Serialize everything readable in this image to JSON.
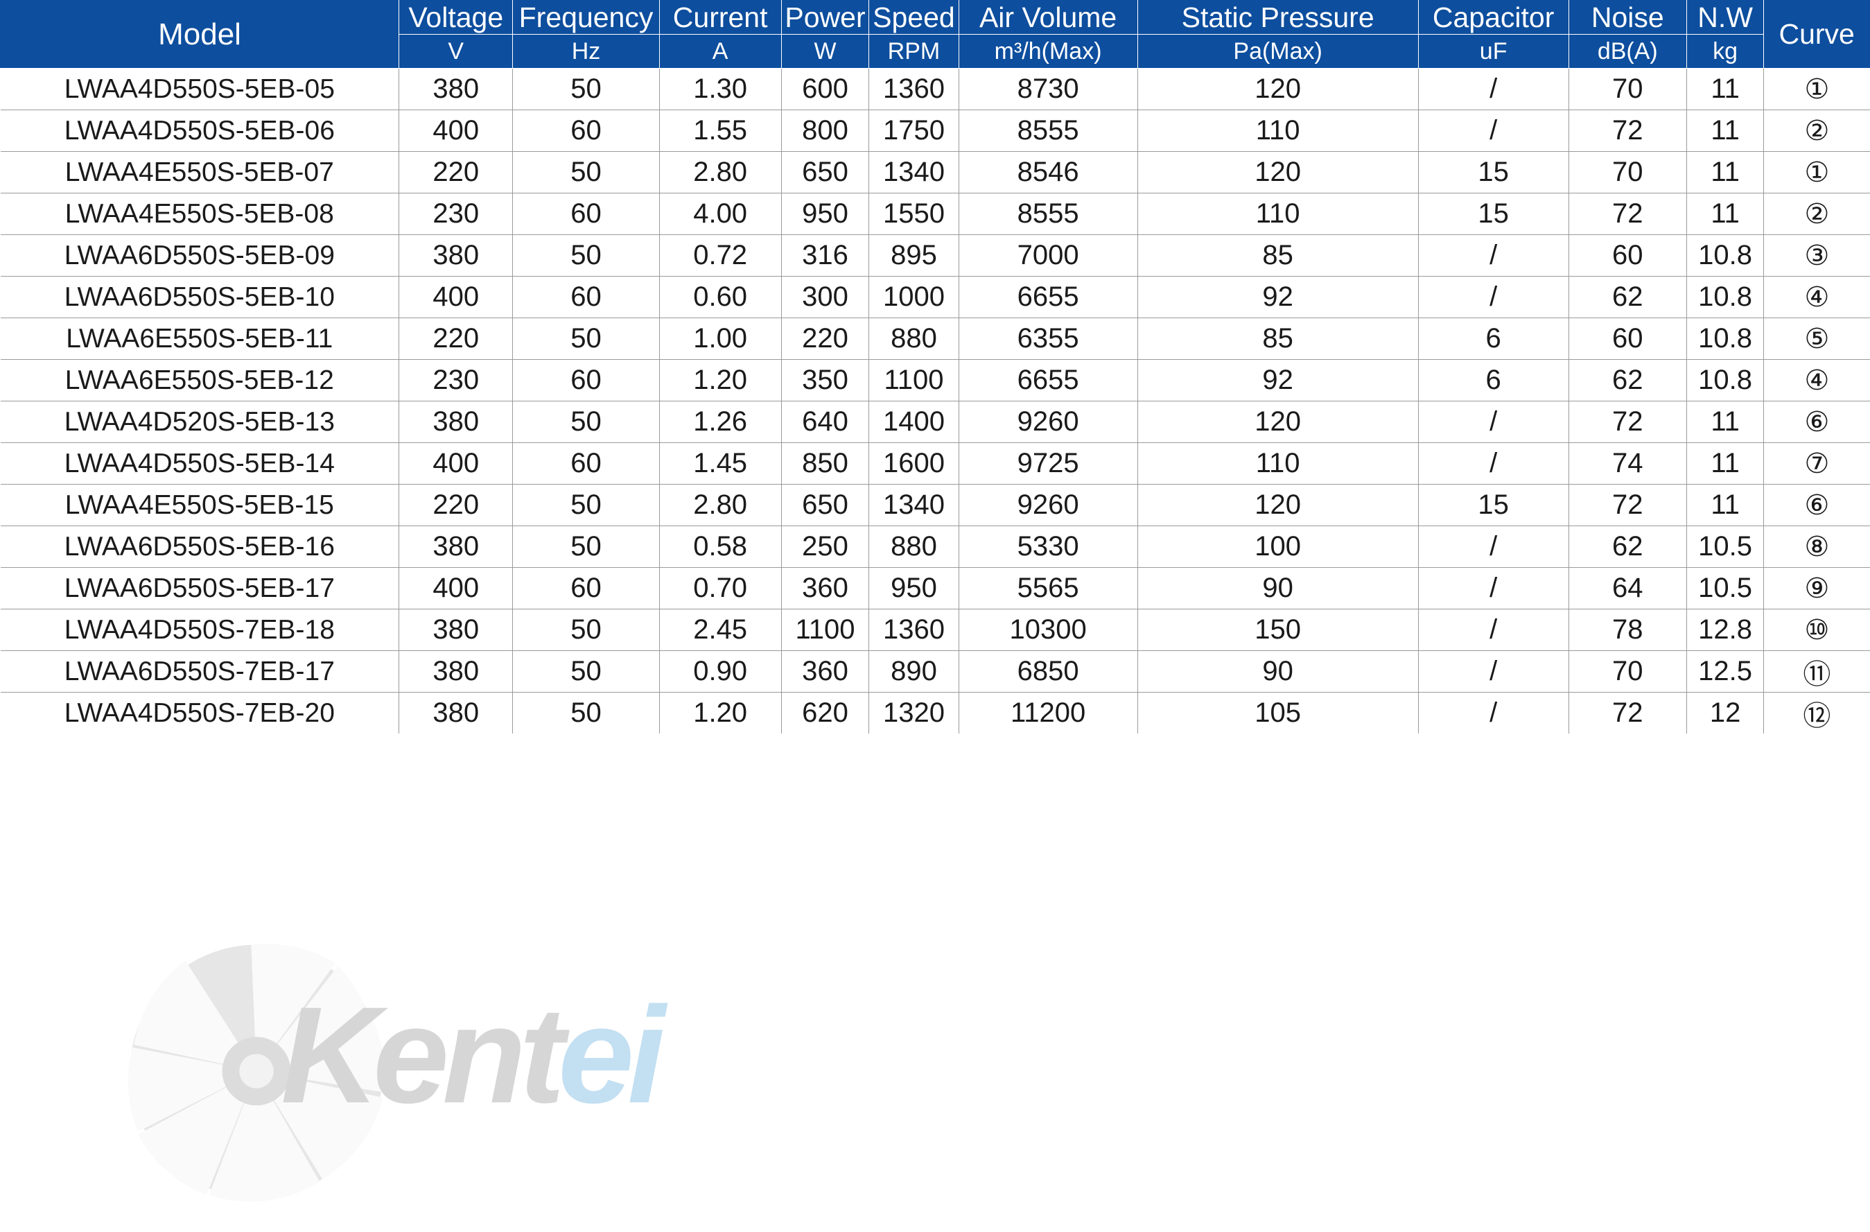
{
  "table": {
    "headers": {
      "model": "Model",
      "curve": "Curve",
      "groups": [
        {
          "title": "Voltage",
          "unit": "V"
        },
        {
          "title": "Frequency",
          "unit": "Hz"
        },
        {
          "title": "Current",
          "unit": "A"
        },
        {
          "title": "Power",
          "unit": "W"
        },
        {
          "title": "Speed",
          "unit": "RPM"
        },
        {
          "title": "Air Volume",
          "unit": "m³/h(Max)"
        },
        {
          "title": "Static Pressure",
          "unit": "Pa(Max)"
        },
        {
          "title": "Capacitor",
          "unit": "uF"
        },
        {
          "title": "Noise",
          "unit": "dB(A)"
        },
        {
          "title": "N.W",
          "unit": "kg"
        }
      ]
    },
    "rows": [
      {
        "model": "LWAA4D550S-5EB-05",
        "voltage": "380",
        "frequency": "50",
        "current": "1.30",
        "power": "600",
        "speed": "1360",
        "air_volume": "8730",
        "static_pressure": "120",
        "capacitor": "/",
        "noise": "70",
        "nw": "11",
        "curve": "①"
      },
      {
        "model": "LWAA4D550S-5EB-06",
        "voltage": "400",
        "frequency": "60",
        "current": "1.55",
        "power": "800",
        "speed": "1750",
        "air_volume": "8555",
        "static_pressure": "110",
        "capacitor": "/",
        "noise": "72",
        "nw": "11",
        "curve": "②"
      },
      {
        "model": "LWAA4E550S-5EB-07",
        "voltage": "220",
        "frequency": "50",
        "current": "2.80",
        "power": "650",
        "speed": "1340",
        "air_volume": "8546",
        "static_pressure": "120",
        "capacitor": "15",
        "noise": "70",
        "nw": "11",
        "curve": "①"
      },
      {
        "model": "LWAA4E550S-5EB-08",
        "voltage": "230",
        "frequency": "60",
        "current": "4.00",
        "power": "950",
        "speed": "1550",
        "air_volume": "8555",
        "static_pressure": "110",
        "capacitor": "15",
        "noise": "72",
        "nw": "11",
        "curve": "②"
      },
      {
        "model": "LWAA6D550S-5EB-09",
        "voltage": "380",
        "frequency": "50",
        "current": "0.72",
        "power": "316",
        "speed": "895",
        "air_volume": "7000",
        "static_pressure": "85",
        "capacitor": "/",
        "noise": "60",
        "nw": "10.8",
        "curve": "③"
      },
      {
        "model": "LWAA6D550S-5EB-10",
        "voltage": "400",
        "frequency": "60",
        "current": "0.60",
        "power": "300",
        "speed": "1000",
        "air_volume": "6655",
        "static_pressure": "92",
        "capacitor": "/",
        "noise": "62",
        "nw": "10.8",
        "curve": "④"
      },
      {
        "model": "LWAA6E550S-5EB-11",
        "voltage": "220",
        "frequency": "50",
        "current": "1.00",
        "power": "220",
        "speed": "880",
        "air_volume": "6355",
        "static_pressure": "85",
        "capacitor": "6",
        "noise": "60",
        "nw": "10.8",
        "curve": "⑤"
      },
      {
        "model": "LWAA6E550S-5EB-12",
        "voltage": "230",
        "frequency": "60",
        "current": "1.20",
        "power": "350",
        "speed": "1100",
        "air_volume": "6655",
        "static_pressure": "92",
        "capacitor": "6",
        "noise": "62",
        "nw": "10.8",
        "curve": "④"
      },
      {
        "model": "LWAA4D520S-5EB-13",
        "voltage": "380",
        "frequency": "50",
        "current": "1.26",
        "power": "640",
        "speed": "1400",
        "air_volume": "9260",
        "static_pressure": "120",
        "capacitor": "/",
        "noise": "72",
        "nw": "11",
        "curve": "⑥"
      },
      {
        "model": "LWAA4D550S-5EB-14",
        "voltage": "400",
        "frequency": "60",
        "current": "1.45",
        "power": "850",
        "speed": "1600",
        "air_volume": "9725",
        "static_pressure": "110",
        "capacitor": "/",
        "noise": "74",
        "nw": "11",
        "curve": "⑦"
      },
      {
        "model": "LWAA4E550S-5EB-15",
        "voltage": "220",
        "frequency": "50",
        "current": "2.80",
        "power": "650",
        "speed": "1340",
        "air_volume": "9260",
        "static_pressure": "120",
        "capacitor": "15",
        "noise": "72",
        "nw": "11",
        "curve": "⑥"
      },
      {
        "model": "LWAA6D550S-5EB-16",
        "voltage": "380",
        "frequency": "50",
        "current": "0.58",
        "power": "250",
        "speed": "880",
        "air_volume": "5330",
        "static_pressure": "100",
        "capacitor": "/",
        "noise": "62",
        "nw": "10.5",
        "curve": "⑧"
      },
      {
        "model": "LWAA6D550S-5EB-17",
        "voltage": "400",
        "frequency": "60",
        "current": "0.70",
        "power": "360",
        "speed": "950",
        "air_volume": "5565",
        "static_pressure": "90",
        "capacitor": "/",
        "noise": "64",
        "nw": "10.5",
        "curve": "⑨"
      },
      {
        "model": "LWAA4D550S-7EB-18",
        "voltage": "380",
        "frequency": "50",
        "current": "2.45",
        "power": "1100",
        "speed": "1360",
        "air_volume": "10300",
        "static_pressure": "150",
        "capacitor": "/",
        "noise": "78",
        "nw": "12.8",
        "curve": "⑩"
      },
      {
        "model": "LWAA6D550S-7EB-17",
        "voltage": "380",
        "frequency": "50",
        "current": "0.90",
        "power": "360",
        "speed": "890",
        "air_volume": "6850",
        "static_pressure": "90",
        "capacitor": "/",
        "noise": "70",
        "nw": "12.5",
        "curve": "⑪"
      },
      {
        "model": "LWAA4D550S-7EB-20",
        "voltage": "380",
        "frequency": "50",
        "current": "1.20",
        "power": "620",
        "speed": "1320",
        "air_volume": "11200",
        "static_pressure": "105",
        "capacitor": "/",
        "noise": "72",
        "nw": "12",
        "curve": "⑫"
      }
    ]
  },
  "watermark": {
    "text_primary": "Kent",
    "text_secondary": "ei",
    "color_primary": "#d6d6d6",
    "color_secondary": "#c3dff2"
  },
  "colors": {
    "header_background": "#0d4e9e",
    "header_text": "#ffffff",
    "grid_line": "#9a9a9a",
    "body_text": "#1a1a1a",
    "page_background": "#ffffff"
  }
}
